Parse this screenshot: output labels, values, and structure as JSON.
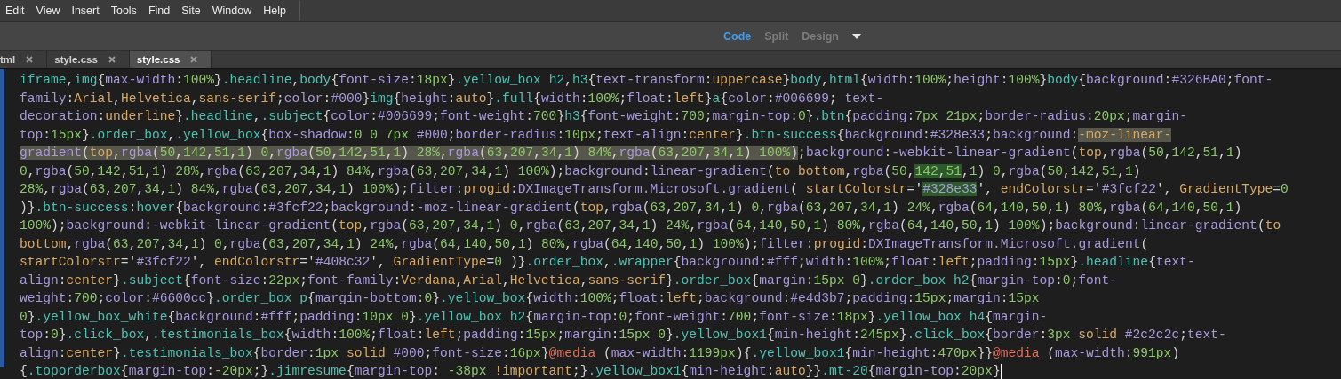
{
  "menu": [
    "Edit",
    "View",
    "Insert",
    "Tools",
    "Find",
    "Site",
    "Window",
    "Help"
  ],
  "view_modes": [
    {
      "label": "Code",
      "selected": true
    },
    {
      "label": "Split",
      "selected": false
    },
    {
      "label": "Design",
      "selected": false
    }
  ],
  "tabs": [
    {
      "label": "tml",
      "selected": false
    },
    {
      "label": "style.css",
      "selected": false
    },
    {
      "label": "style.css",
      "selected": true
    }
  ],
  "code_lines": [
    {
      "segments": [
        {
          "text": "iframe,img{max-width:100%}.headline,body{font-size:18px}.yellow_box h2,h3{text-transform:uppercase}body,html{width:100%;height:100%}body{background:#326BA0;font-",
          "selected": false,
          "matched": false
        }
      ]
    },
    {
      "segments": [
        {
          "text": "family:Arial,Helvetica,sans-serif;color:#000}img{height:auto}.full{width:100%;float:left}a{color:#006699; text-",
          "selected": false,
          "matched": false
        }
      ]
    },
    {
      "segments": [
        {
          "text": "decoration:underline}.headline,.subject{color:#006699;font-weight:700}h3{font-weight:700;margin-top:0}.btn{padding:7px 21px;border-radius:20px;margin-",
          "selected": false,
          "matched": false
        }
      ]
    },
    {
      "segments": [
        {
          "text": "top:15px}.order_box,.yellow_box{box-shadow:0 0 7px #000;border-radius:10px;text-align:center}.btn-success{background:#328e33;background:",
          "selected": false,
          "matched": false
        },
        {
          "text": "-moz-linear-",
          "selected": true,
          "matched": false
        }
      ]
    },
    {
      "segments": [
        {
          "text": "gradient(top,rgba(50,142,51,1) 0,rgba(50,142,51,1) 28%,rgba(63,207,34,1) 84%,rgba(63,207,34,1) 100%)",
          "selected": true,
          "matched": false
        },
        {
          "text": ";background:-webkit-linear-gradient(top,rgba(50,142,51,1)",
          "selected": false,
          "matched": false
        }
      ]
    },
    {
      "segments": [
        {
          "text": "0,rgba(50,142,51,1) 28%,rgba(63,207,34,1) 84%,rgba(63,207,34,1) 100%);background:linear-gradient(to bottom,rgba(50,",
          "selected": false,
          "matched": false
        },
        {
          "text": "142,51",
          "selected": false,
          "matched": true
        },
        {
          "text": ",1) 0,rgba(50,142,51,1)",
          "selected": false,
          "matched": false
        }
      ]
    },
    {
      "segments": [
        {
          "text": "28%,rgba(63,207,34,1) 84%,rgba(63,207,34,1) 100%);filter:progid:DXImageTransform.Microsoft.gradient( startColorstr='",
          "selected": false,
          "matched": false
        },
        {
          "text": "#328e33",
          "selected": false,
          "matched": true
        },
        {
          "text": "', endColorstr='#3fcf22', GradientType=0",
          "selected": false,
          "matched": false
        }
      ]
    },
    {
      "segments": [
        {
          "text": ")}.btn-success:hover{background:#3fcf22;background:-moz-linear-gradient(top,rgba(63,207,34,1) 0,rgba(63,207,34,1) 24%,rgba(64,140,50,1) 80%,rgba(64,140,50,1)",
          "selected": false,
          "matched": false
        }
      ]
    },
    {
      "segments": [
        {
          "text": "100%);background:-webkit-linear-gradient(top,rgba(63,207,34,1) 0,rgba(63,207,34,1) 24%,rgba(64,140,50,1) 80%,rgba(64,140,50,1) 100%);background:linear-gradient(to",
          "selected": false,
          "matched": false
        }
      ]
    },
    {
      "segments": [
        {
          "text": "bottom,rgba(63,207,34,1) 0,rgba(63,207,34,1) 24%,rgba(64,140,50,1) 80%,rgba(64,140,50,1) 100%);filter:progid:DXImageTransform.Microsoft.gradient(",
          "selected": false,
          "matched": false
        }
      ]
    },
    {
      "segments": [
        {
          "text": "startColorstr='#3fcf22', endColorstr='#408c32', GradientType=0 )}.order_box,.wrapper{background:#fff;width:100%;float:left;padding:15px}.headline{text-",
          "selected": false,
          "matched": false
        }
      ]
    },
    {
      "segments": [
        {
          "text": "align:center}.subject{font-size:22px;font-family:Verdana,Arial,Helvetica,sans-serif}.order_box{margin:15px 0}.order_box h2{margin-top:0;font-",
          "selected": false,
          "matched": false
        }
      ]
    },
    {
      "segments": [
        {
          "text": "weight:700;color:#6600cc}.order_box p{margin-bottom:0}.yellow_box{width:100%;float:left;background:#e4d3b7;padding:15px;margin:15px",
          "selected": false,
          "matched": false
        }
      ]
    },
    {
      "segments": [
        {
          "text": "0}.yellow_box_white{background:#fff;padding:10px 0}.yellow_box h2{margin-top:0;font-weight:700;font-size:18px}.yellow_box h4{margin-",
          "selected": false,
          "matched": false
        }
      ]
    },
    {
      "segments": [
        {
          "text": "top:0}.click_box,.testimonials_box{width:100%;float:left;padding:15px;margin:15px 0}.yellow_box1{min-height:245px}.click_box{border:3px solid #2c2c2c;text-",
          "selected": false,
          "matched": false
        }
      ]
    },
    {
      "segments": [
        {
          "text": "align:center}.testimonials_box{border:1px solid #000;font-size:16px}@media (max-width:1199px){.yellow_box1{min-height:470px}}@media (max-width:991px)",
          "selected": false,
          "matched": false
        }
      ]
    },
    {
      "segments": [
        {
          "text": "{.toporderbox{margin-top:-20px;}.jimresume{margin-top: -38px !important;}.yellow_box1{min-height:auto}}.mt-20{margin-top:20px}",
          "selected": false,
          "matched": false
        }
      ]
    }
  ]
}
